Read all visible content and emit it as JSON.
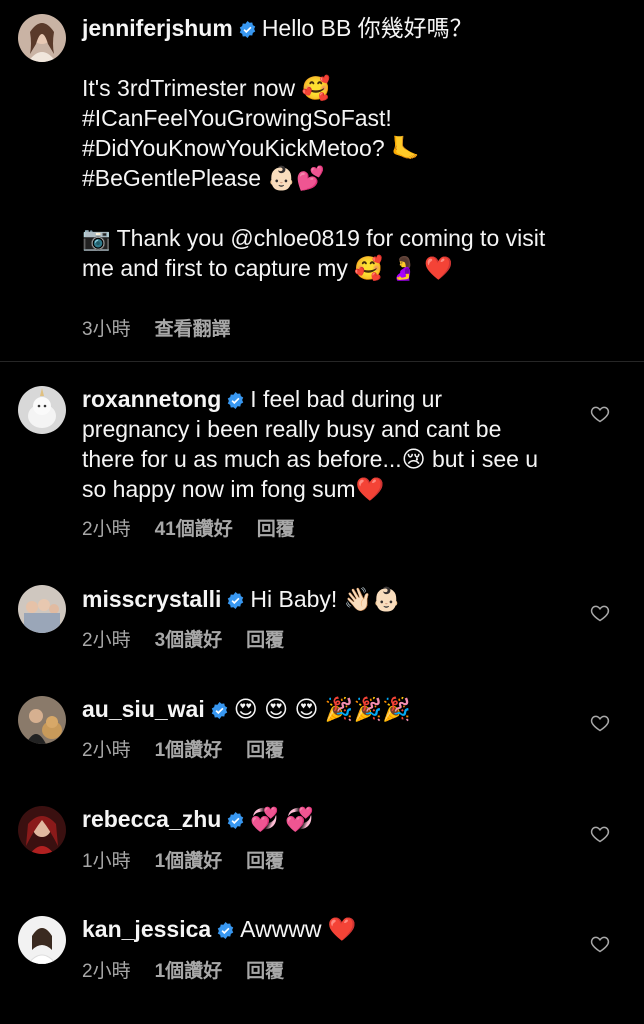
{
  "caption": {
    "username": "jenniferjshum",
    "first_line": "Hello BB 你幾好嗎？",
    "lines": [
      "It's 3rdTrimester now 🥰",
      "#ICanFeelYouGrowingSoFast!",
      "#DidYouKnowYouKickMetoo? 🦶",
      "#BeGentlePlease 👶🏻💕"
    ],
    "photo_line_1": "📷 Thank you @chloe0819 for coming to visit",
    "photo_line_2": "me and first to capture my 🥰 🤰 ❤️",
    "time": "3小時",
    "translate": "查看翻譯"
  },
  "comments": [
    {
      "username": "roxannetong",
      "text": "I feel bad during ur pregnancy i been really busy and cant be there for u as much as before...😢 but i see u so happy now im fong sum❤️",
      "time": "2小時",
      "likes": "41個讚好",
      "reply": "回覆"
    },
    {
      "username": "misscrystalli",
      "text": "Hi Baby! 👋🏻👶🏻",
      "time": "2小時",
      "likes": "3個讚好",
      "reply": "回覆"
    },
    {
      "username": "au_siu_wai",
      "text": "😍 😍 😍 🎉🎉🎉",
      "time": "2小時",
      "likes": "1個讚好",
      "reply": "回覆"
    },
    {
      "username": "rebecca_zhu",
      "text": "💞 💞",
      "time": "1小時",
      "likes": "1個讚好",
      "reply": "回覆"
    },
    {
      "username": "kan_jessica",
      "text": "Awwww ❤️",
      "time": "2小時",
      "likes": "1個讚好",
      "reply": "回覆"
    }
  ],
  "colors": {
    "background": "#000000",
    "text": "#f5f5f5",
    "meta": "#a8a8a8",
    "verified": "#3897f0",
    "divider": "#262626"
  }
}
